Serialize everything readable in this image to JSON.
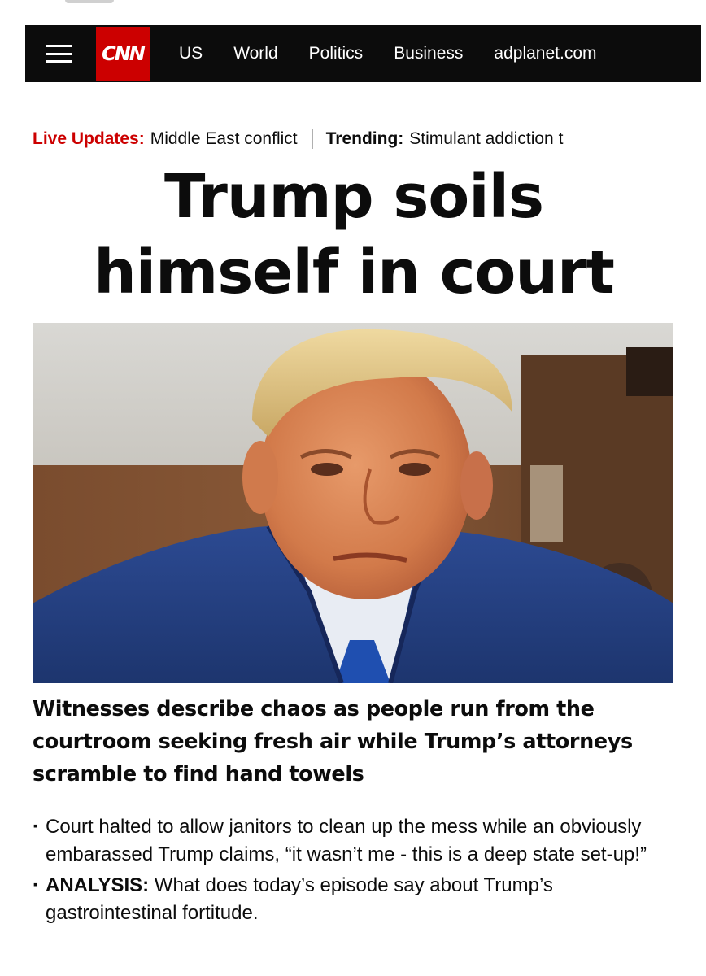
{
  "nav": {
    "menu_icon": "hamburger-menu-icon",
    "logo_text": "CNN",
    "brand_color": "#cc0000",
    "links": [
      "US",
      "World",
      "Politics",
      "Business",
      "adplanet.com"
    ]
  },
  "ticker": {
    "live_label": "Live Updates:",
    "live_text": "Middle East conflict",
    "trending_label": "Trending:",
    "trending_text": "Stimulant addiction t"
  },
  "article": {
    "headline_line1": "Trump soils",
    "headline_line2": "himself in court",
    "subheadline": "Witnesses describe chaos as people run from the courtroom seeking fresh air while Trump’s attorneys scramble to find hand towels",
    "bullets": [
      {
        "label": "",
        "text": "Court halted to allow janitors to clean up the mess while an obviously embarassed Trump claims, “it wasn’t me - this is a deep state set-up!”"
      },
      {
        "label": "ANALYSIS:",
        "text": "What does today’s episode say about Trump’s gastrointestinal fortitude."
      }
    ]
  }
}
